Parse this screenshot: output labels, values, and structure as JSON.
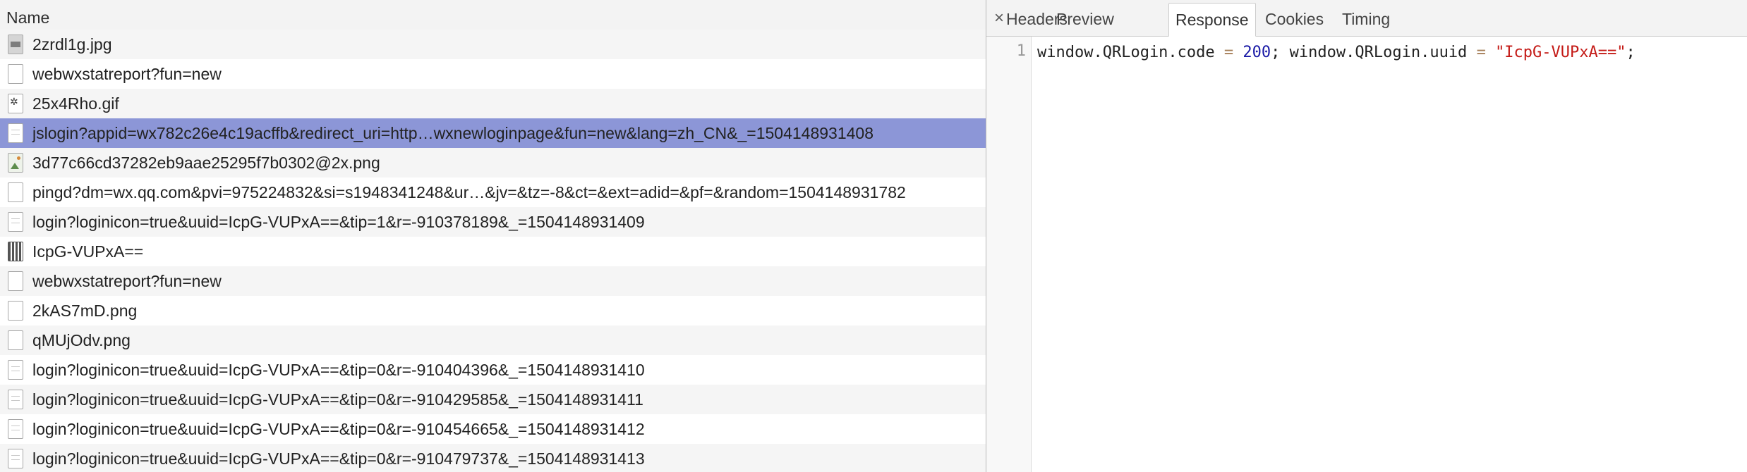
{
  "list": {
    "header": "Name",
    "rows": [
      {
        "name": "2zrdl1g.jpg",
        "icon": "image-dark-file-icon",
        "icon_class": "img-dark"
      },
      {
        "name": "webwxstatreport?fun=new",
        "icon": "blank-file-icon",
        "icon_class": "blank"
      },
      {
        "name": "25x4Rho.gif",
        "icon": "gif-file-icon",
        "icon_class": "img-gif"
      },
      {
        "name": "jslogin?appid=wx782c26e4c19acffb&redirect_uri=http…wxnewloginpage&fun=new&lang=zh_CN&_=1504148931408",
        "icon": "script-file-icon",
        "icon_class": "doc",
        "selected": true
      },
      {
        "name": "3d77c66cd37282eb9aae25295f7b0302@2x.png",
        "icon": "image-file-icon",
        "icon_class": "img-pic"
      },
      {
        "name": "pingd?dm=wx.qq.com&pvi=975224832&si=s1948341248&ur…&jv=&tz=-8&ct=&ext=adid=&pf=&random=1504148931782",
        "icon": "blank-file-icon",
        "icon_class": "blank"
      },
      {
        "name": "login?loginicon=true&uuid=IcpG-VUPxA==&tip=1&r=-910378189&_=1504148931409",
        "icon": "script-file-icon",
        "icon_class": "doc"
      },
      {
        "name": "IcpG-VUPxA==",
        "icon": "qr-image-icon",
        "icon_class": "img-qr"
      },
      {
        "name": "webwxstatreport?fun=new",
        "icon": "blank-file-icon",
        "icon_class": "blank"
      },
      {
        "name": "2kAS7mD.png",
        "icon": "blank-file-icon",
        "icon_class": "blank"
      },
      {
        "name": "qMUjOdv.png",
        "icon": "blank-file-icon",
        "icon_class": "blank"
      },
      {
        "name": "login?loginicon=true&uuid=IcpG-VUPxA==&tip=0&r=-910404396&_=1504148931410",
        "icon": "script-file-icon",
        "icon_class": "doc"
      },
      {
        "name": "login?loginicon=true&uuid=IcpG-VUPxA==&tip=0&r=-910429585&_=1504148931411",
        "icon": "script-file-icon",
        "icon_class": "doc"
      },
      {
        "name": "login?loginicon=true&uuid=IcpG-VUPxA==&tip=0&r=-910454665&_=1504148931412",
        "icon": "script-file-icon",
        "icon_class": "doc"
      },
      {
        "name": "login?loginicon=true&uuid=IcpG-VUPxA==&tip=0&r=-910479737&_=1504148931413",
        "icon": "script-file-icon",
        "icon_class": "doc"
      }
    ]
  },
  "details": {
    "close_glyph": "×",
    "tabs": [
      {
        "label": "Headers",
        "active": false
      },
      {
        "label": "Preview",
        "active": false
      },
      {
        "label": "Response",
        "active": true
      },
      {
        "label": "Cookies",
        "active": false
      },
      {
        "label": "Timing",
        "active": false
      }
    ],
    "response": {
      "line_number": "1",
      "code_tokens": [
        {
          "text": "window.QRLogin.code ",
          "kind": "plain"
        },
        {
          "text": "=",
          "kind": "op"
        },
        {
          "text": " ",
          "kind": "plain"
        },
        {
          "text": "200",
          "kind": "num"
        },
        {
          "text": "; window.QRLogin.uuid ",
          "kind": "plain"
        },
        {
          "text": "=",
          "kind": "op"
        },
        {
          "text": " ",
          "kind": "plain"
        },
        {
          "text": "\"IcpG-VUPxA==\"",
          "kind": "str"
        },
        {
          "text": ";",
          "kind": "plain"
        }
      ]
    }
  },
  "colors": {
    "selected_row": "#8c96d7",
    "alt_row": "#f5f5f5",
    "number_token": "#1a1aa6",
    "string_token": "#c41a16",
    "operator_token": "#a67f59"
  }
}
